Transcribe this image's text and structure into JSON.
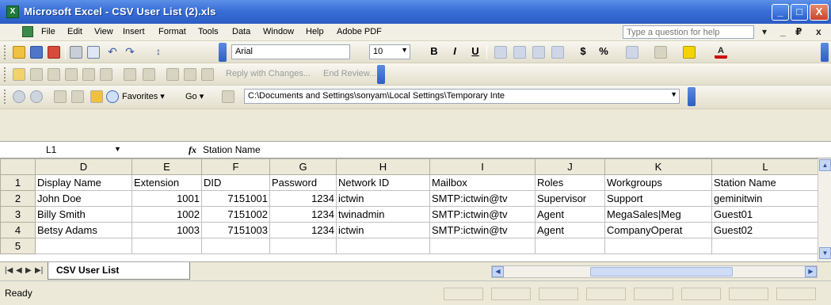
{
  "window": {
    "title": "Microsoft Excel - CSV User List (2).xls",
    "minimize": "_",
    "maximize": "□",
    "close": "X"
  },
  "menu": {
    "items": [
      "File",
      "Edit",
      "View",
      "Insert",
      "Format",
      "Tools",
      "Data",
      "Window",
      "Help",
      "Adobe PDF"
    ],
    "help_placeholder": "Type a question for help",
    "controls": [
      "▾",
      "_",
      "₽",
      "x"
    ]
  },
  "toolbar_standard": {
    "font_name": "Arial",
    "font_size": "10",
    "bold": "B",
    "italic": "I",
    "underline": "U",
    "currency": "$",
    "percent": "%"
  },
  "toolbar_reviewing": {
    "reply_with_changes": "Reply with Changes...",
    "end_review": "End Review..."
  },
  "toolbar_web": {
    "favorites": "Favorites",
    "go": "Go",
    "address": "C:\\Documents and Settings\\sonyam\\Local Settings\\Temporary Inte"
  },
  "formula_bar": {
    "cell_ref": "L1",
    "fx": "fx",
    "content": "Station Name"
  },
  "sheet": {
    "columns": [
      "D",
      "E",
      "F",
      "G",
      "H",
      "I",
      "J",
      "K",
      "L"
    ],
    "rows": [
      {
        "n": "1",
        "cells": [
          "Display Name",
          "Extension",
          "DID",
          "Password",
          "Network ID",
          "Mailbox",
          "Roles",
          "Workgroups",
          "Station Name"
        ]
      },
      {
        "n": "2",
        "cells": [
          "John Doe",
          "1001",
          "7151001",
          "1234",
          "ictwin",
          "SMTP:ictwin@tv",
          "Supervisor",
          "Support",
          "geminitwin"
        ]
      },
      {
        "n": "3",
        "cells": [
          "Billy Smith",
          "1002",
          "7151002",
          "1234",
          "twinadmin",
          "SMTP:ictwin@tv",
          "Agent",
          "MegaSales|Meg",
          "Guest01"
        ]
      },
      {
        "n": "4",
        "cells": [
          "Betsy Adams",
          "1003",
          "7151003",
          "1234",
          "ictwin",
          "SMTP:ictwin@tv",
          "Agent",
          "CompanyOperat",
          "Guest02"
        ]
      },
      {
        "n": "5",
        "cells": [
          "",
          "",
          "",
          "",
          "",
          "",
          "",
          "",
          ""
        ]
      }
    ]
  },
  "tabs": {
    "active": "CSV User List",
    "nav": [
      "|◀",
      "◀",
      "▶",
      "▶|"
    ]
  },
  "status": {
    "text": "Ready"
  },
  "colors": {
    "titlebar": "#3a6fd8",
    "chrome": "#ece9d8",
    "close_button": "#c9452a"
  }
}
